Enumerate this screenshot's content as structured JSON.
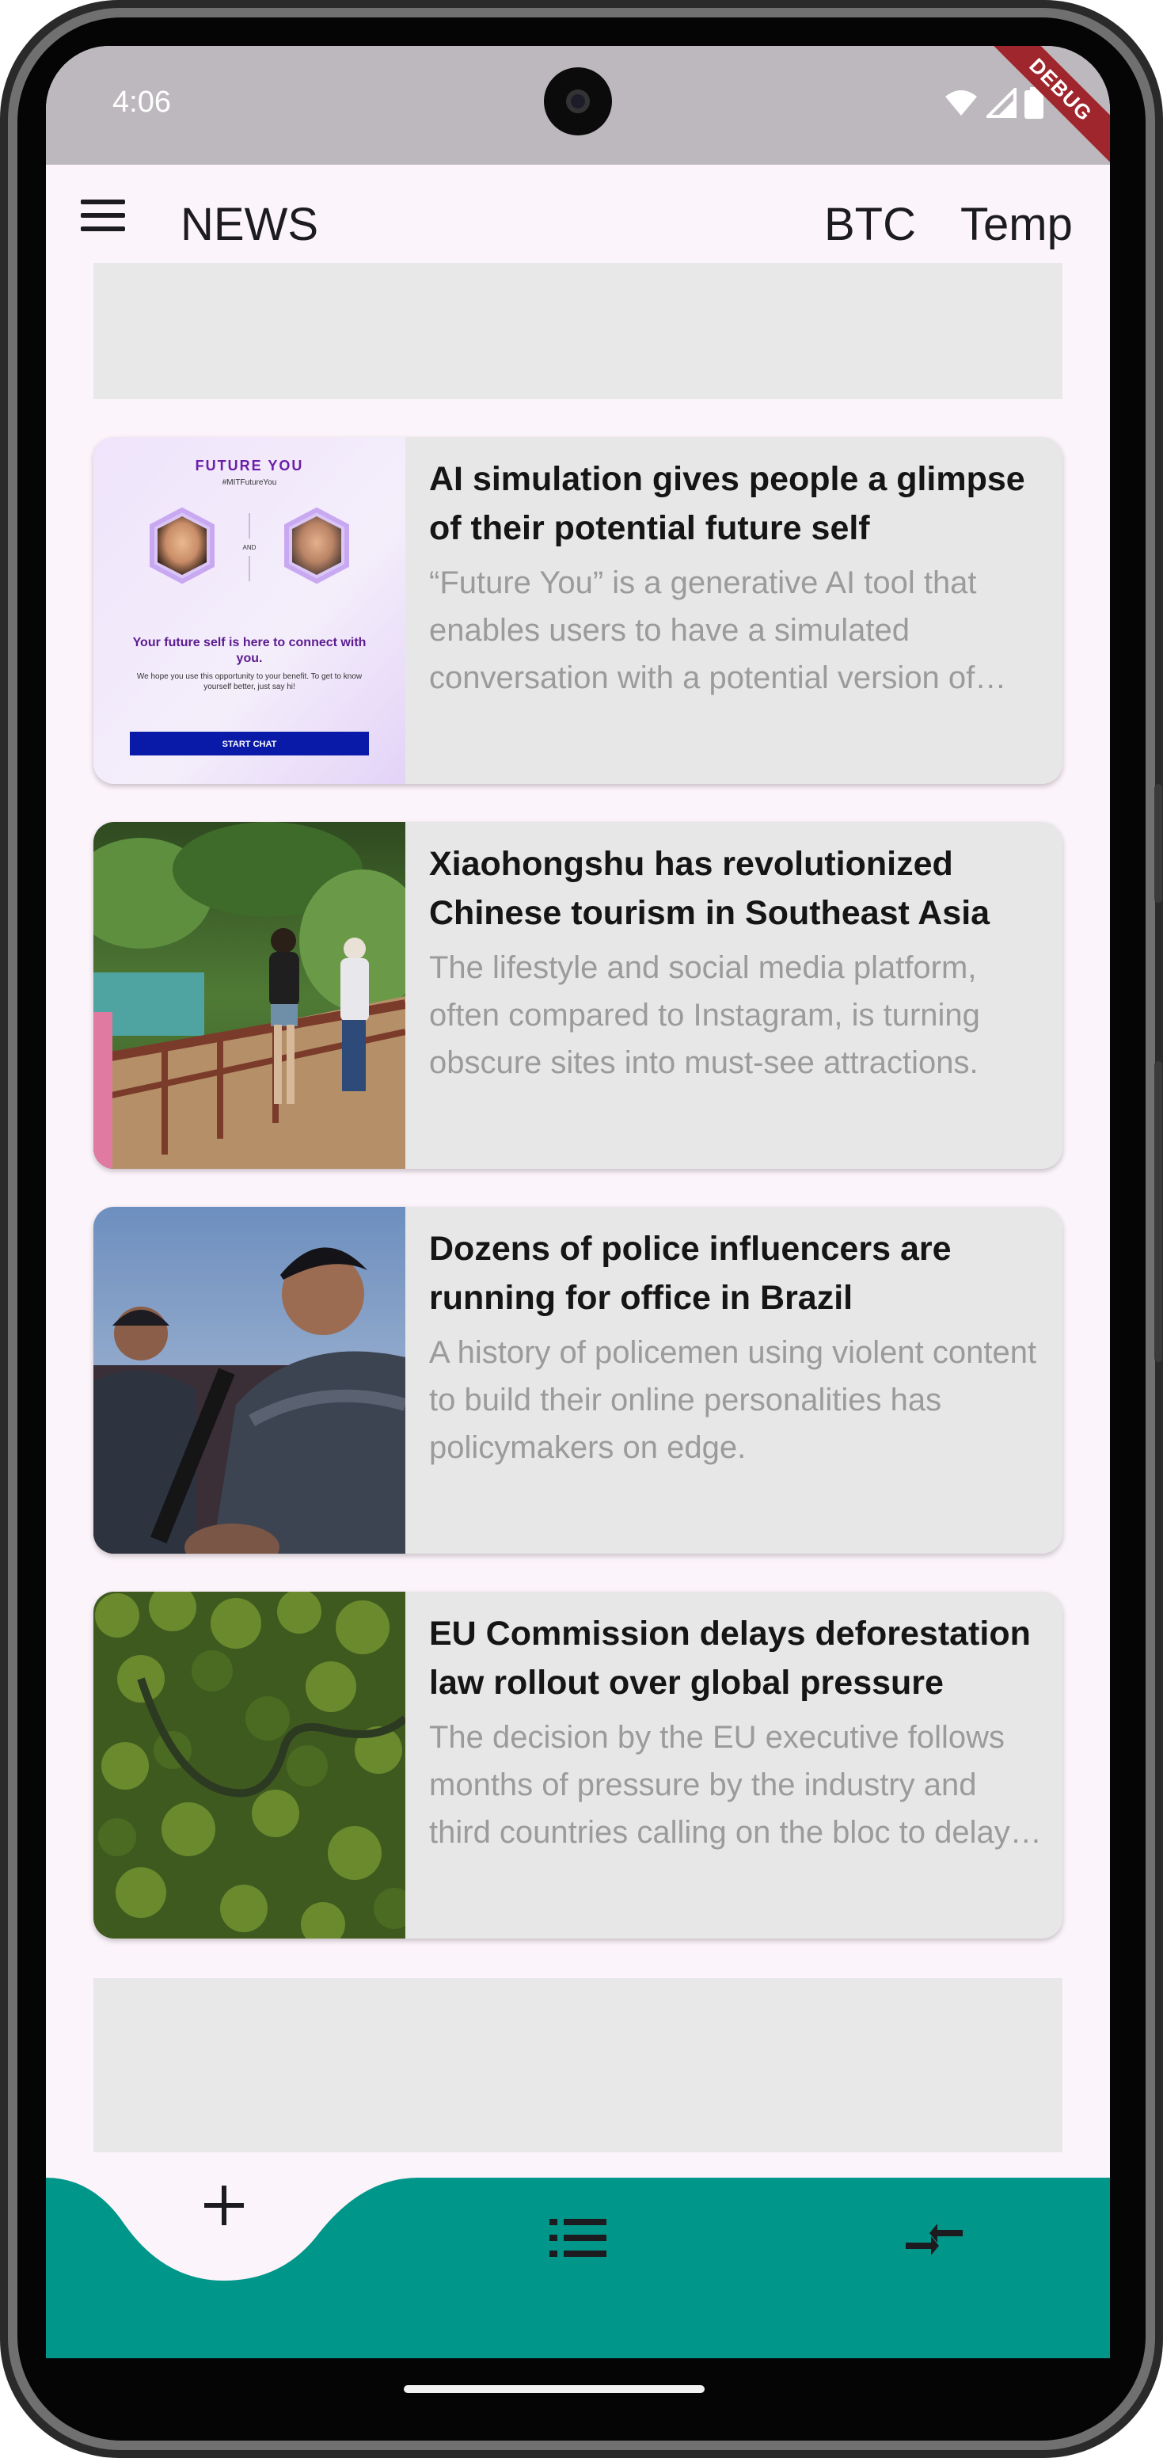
{
  "status_bar": {
    "time": "4:06",
    "debug_label": "DEBUG"
  },
  "app_bar": {
    "title": "NEWS",
    "actions": [
      "BTC",
      "Temp"
    ]
  },
  "articles": [
    {
      "title": "AI simulation gives people a glimpse of their potential future self",
      "description": "“Future You” is a generative AI tool that enables users to have a simulated conversation with a potential version of themselves…",
      "thumb": {
        "heading": "FUTURE YOU",
        "hashtag": "#MITFutureYou",
        "and_label": "AND",
        "tagline": "Your future self is here to connect with you.",
        "fine_print": "We hope you use this opportunity to your benefit. To get to know yourself better, just say hi!",
        "button": "START CHAT"
      }
    },
    {
      "title": "Xiaohongshu has revolutionized Chinese tourism in Southeast Asia",
      "description": "The lifestyle and social media platform, often compared to Instagram, is turning obscure sites into must-see attractions."
    },
    {
      "title": "Dozens of police influencers are running for office in Brazil",
      "description": "A history of policemen using violent content to build their online personalities has policymakers on edge."
    },
    {
      "title": "EU Commission delays deforestation law rollout over global pressure",
      "description": "The decision by the EU executive follows months of pressure by the industry and third countries calling on the bloc to delay…"
    }
  ],
  "bottom_nav": {
    "color": "#00968a",
    "items": [
      "add-icon",
      "list-icon",
      "compare-arrows-icon"
    ]
  }
}
